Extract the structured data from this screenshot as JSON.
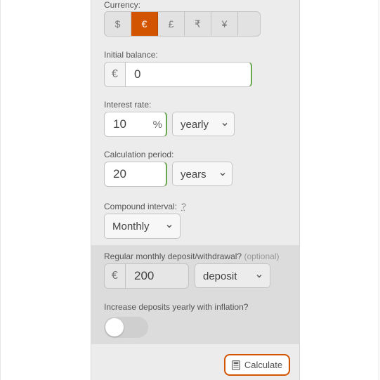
{
  "currency": {
    "label": "Currency:",
    "options": [
      "$",
      "€",
      "£",
      "₹",
      "¥",
      ""
    ],
    "selected": "€",
    "accent_color": "#d35400"
  },
  "initial_balance": {
    "label": "Initial balance:",
    "prefix": "€",
    "value": "0"
  },
  "interest_rate": {
    "label": "Interest rate:",
    "value": "10",
    "suffix": "%",
    "period_selected": "yearly"
  },
  "calculation_period": {
    "label": "Calculation period:",
    "value": "20",
    "unit_selected": "years"
  },
  "compound_interval": {
    "label": "Compound interval:",
    "help": "?",
    "selected": "Monthly"
  },
  "regular_deposit": {
    "label": "Regular monthly deposit/withdrawal?",
    "optional": "(optional)",
    "prefix": "€",
    "value": "200",
    "type_selected": "deposit"
  },
  "inflation": {
    "label": "Increase deposits yearly with inflation?",
    "enabled": false
  },
  "calculate_button": {
    "label": "Calculate",
    "icon": "calculator-icon"
  }
}
